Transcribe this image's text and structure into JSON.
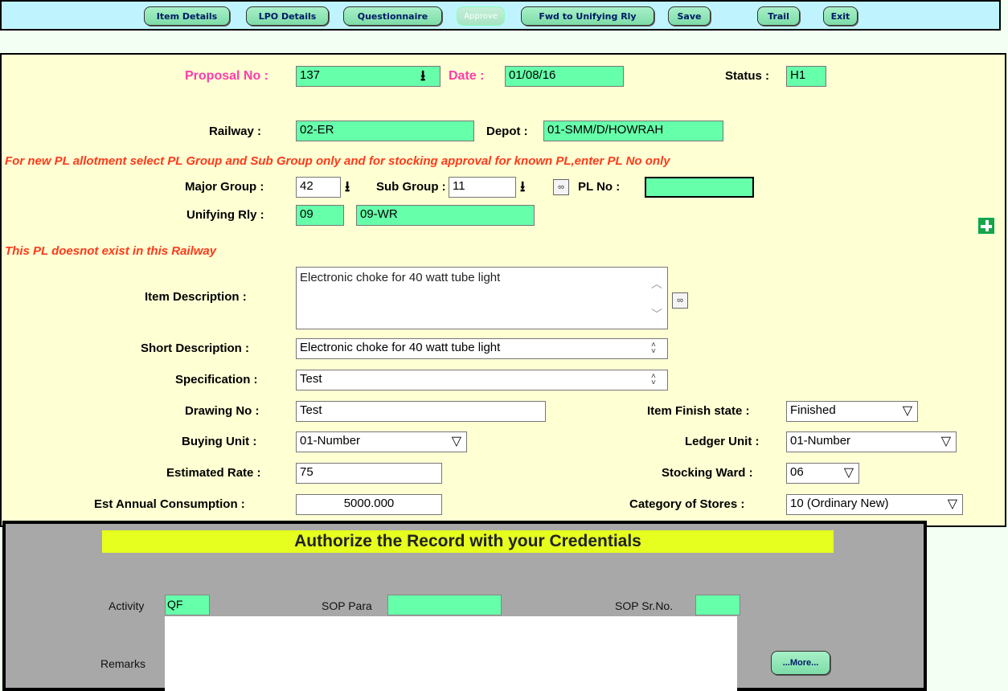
{
  "toolbar": {
    "item_details": "Item Details",
    "lpo_details": "LPO Details",
    "questionnaire": "Questionnaire",
    "approve": "Approve",
    "fwd_unifying": "Fwd to Unifying Rly",
    "save": "Save",
    "trail": "Trail",
    "exit": "Exit"
  },
  "form": {
    "proposal_label": "Proposal No :",
    "proposal_value": "137",
    "date_label": "Date :",
    "date_value": "01/08/16",
    "status_label": "Status :",
    "status_value": "H1",
    "railway_label": "Railway :",
    "railway_value": "02-ER",
    "depot_label": "Depot :",
    "depot_value": "01-SMM/D/HOWRAH",
    "note_allotment": "For new PL allotment select PL Group and Sub Group only and for stocking approval for known PL,enter PL No only",
    "major_group_label": "Major Group :",
    "major_group_value": "42",
    "sub_group_label": "Sub Group :",
    "sub_group_value": "11",
    "pl_no_label": "PL No :",
    "pl_no_value": "",
    "unifying_rly_label": "Unifying Rly :",
    "unifying_rly_code": "09",
    "unifying_rly_name": "09-WR",
    "note_pl": "This PL doesnot exist in this Railway",
    "item_desc_label": "Item Description :",
    "item_desc_value": "Electronic choke for 40 watt tube light",
    "short_desc_label": "Short Description :",
    "short_desc_value": "Electronic choke for 40 watt tube light",
    "spec_label": "Specification :",
    "spec_value": "Test",
    "drawing_label": "Drawing No :",
    "drawing_value": "Test",
    "finish_label": "Item Finish state :",
    "finish_value": "Finished",
    "buying_unit_label": "Buying Unit :",
    "buying_unit_value": "01-Number",
    "ledger_unit_label": "Ledger Unit :",
    "ledger_unit_value": "01-Number",
    "est_rate_label": "Estimated Rate :",
    "est_rate_value": "75",
    "stocking_ward_label": "Stocking Ward :",
    "stocking_ward_value": "06",
    "est_annual_label": "Est Annual Consumption :",
    "est_annual_value": "5000.000",
    "category_label": "Category of Stores :",
    "category_value": "10 (Ordinary New)"
  },
  "dialog": {
    "title": "Authorize the Record with your Credentials",
    "activity_label": "Activity",
    "activity_value": "QF",
    "sop_para_label": "SOP Para",
    "sop_para_value": "",
    "sop_srno_label": "SOP Sr.No.",
    "sop_srno_value": "",
    "remarks_label": "Remarks",
    "more_button": "...More..."
  }
}
